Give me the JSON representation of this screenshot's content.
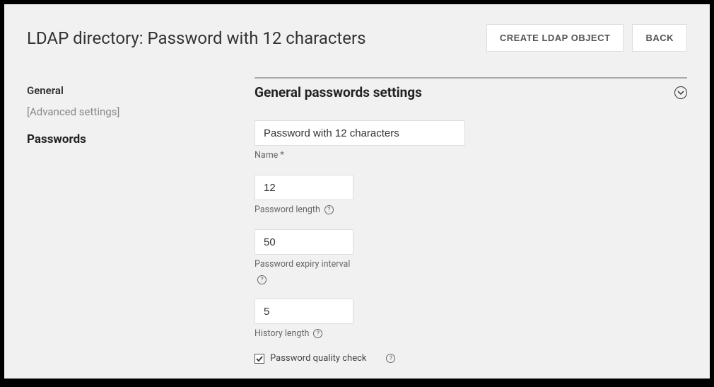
{
  "header": {
    "title": "LDAP directory: Password with 12 characters",
    "create_button": "CREATE LDAP OBJECT",
    "back_button": "BACK"
  },
  "sidebar": {
    "general": "General",
    "advanced": "[Advanced settings]",
    "passwords": "Passwords"
  },
  "section": {
    "title": "General passwords settings"
  },
  "fields": {
    "name": {
      "value": "Password with 12 characters",
      "label": "Name *"
    },
    "length": {
      "value": "12",
      "label": "Password length"
    },
    "expiry": {
      "value": "50",
      "label": "Password expiry interval"
    },
    "history": {
      "value": "5",
      "label": "History length"
    },
    "quality_check": {
      "label": "Password quality check",
      "checked": true
    }
  }
}
